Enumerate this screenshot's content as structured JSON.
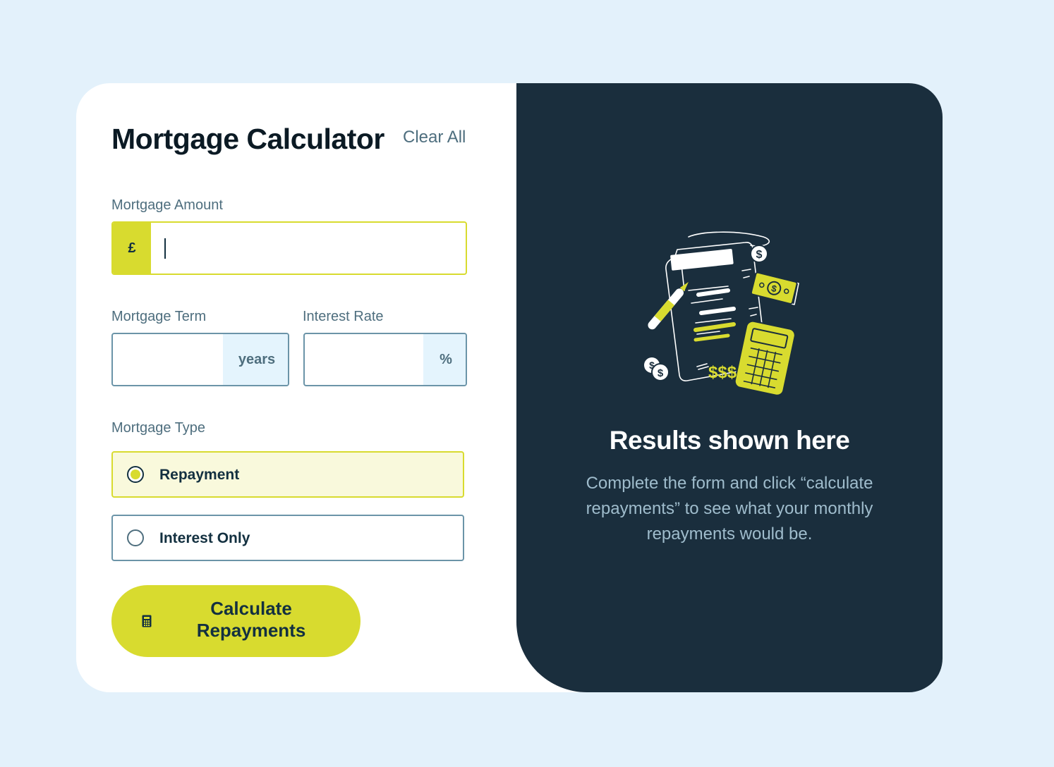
{
  "form": {
    "title": "Mortgage Calculator",
    "clear_all": "Clear All",
    "amount": {
      "label": "Mortgage Amount",
      "prefix": "£",
      "value": ""
    },
    "term": {
      "label": "Mortgage Term",
      "suffix": "years",
      "value": ""
    },
    "rate": {
      "label": "Interest Rate",
      "suffix": "%",
      "value": ""
    },
    "type": {
      "label": "Mortgage Type",
      "options": [
        {
          "label": "Repayment",
          "selected": true
        },
        {
          "label": "Interest Only",
          "selected": false
        }
      ]
    },
    "calculate_button": "Calculate Repayments",
    "calculate_icon": "calculator-icon"
  },
  "results": {
    "title": "Results shown here",
    "description": "Complete the form and click “calculate repayments” to see what your monthly repayments would be.",
    "illustration": "empty-results-illustration"
  },
  "colors": {
    "page_bg": "#e3f1fb",
    "accent_lime": "#d8db2f",
    "dark_panel": "#1a2e3d",
    "slate_text": "#4e6e7e",
    "border_slate": "#6b94a8"
  }
}
